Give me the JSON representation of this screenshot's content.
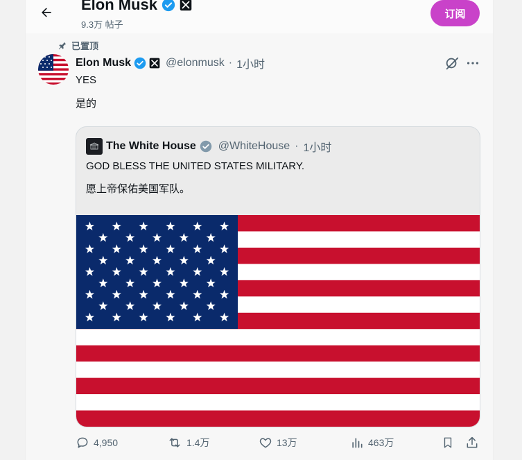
{
  "header": {
    "title": "Elon Musk",
    "post_count": "9.3万 帖子",
    "subscribe_label": "订阅"
  },
  "pinned_label": "已置顶",
  "tweet": {
    "author_name": "Elon Musk",
    "handle": "@elonmusk",
    "separator": "·",
    "time": "1小时",
    "text_en": "YES",
    "text_zh": "是的",
    "quote": {
      "author_name": "The White House",
      "handle": "@WhiteHouse",
      "separator": "·",
      "time": "1小时",
      "text_en": "GOD BLESS THE UNITED STATES MILITARY.",
      "text_zh": "愿上帝保佑美国军队。"
    },
    "stats": {
      "replies": "4,950",
      "reposts": "1.4万",
      "likes": "13万",
      "views": "463万"
    }
  },
  "colors": {
    "subscribe": "#c942c9",
    "verified": "#1d9bf0",
    "flag_red": "#c8102e",
    "flag_blue": "#0a2a6b"
  },
  "icons": [
    "back-arrow-icon",
    "verified-badge-icon",
    "x-affiliate-icon",
    "pin-icon",
    "grok-icon",
    "more-icon",
    "reply-icon",
    "repost-icon",
    "like-icon",
    "views-icon",
    "bookmark-icon",
    "share-icon"
  ]
}
